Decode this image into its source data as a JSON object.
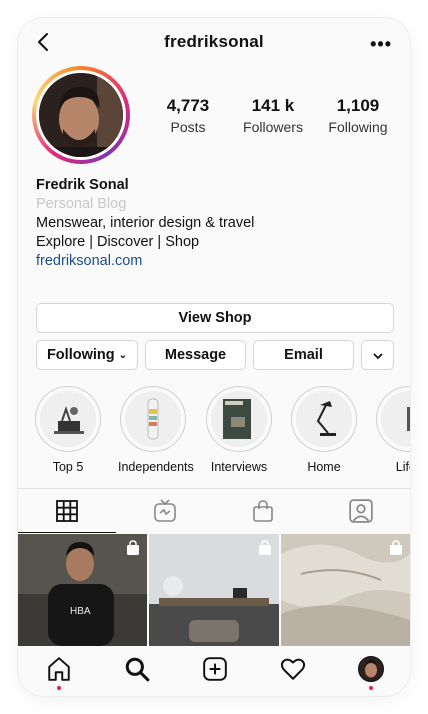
{
  "header": {
    "username": "fredriksonal",
    "more_icon": "more-icon"
  },
  "profile": {
    "stats": [
      {
        "value": "4,773",
        "label": "Posts"
      },
      {
        "value": "141 k",
        "label": "Followers"
      },
      {
        "value": "1,109",
        "label": "Following"
      }
    ],
    "name": "Fredrik Sonal",
    "category": "Personal Blog",
    "bio_line1": "Menswear, interior design & travel",
    "bio_line2": "Explore | Discover | Shop",
    "link": "fredriksonal.com"
  },
  "actions": {
    "view_shop": "View Shop",
    "following": "Following",
    "message": "Message",
    "email": "Email"
  },
  "highlights": [
    {
      "label": "Top 5"
    },
    {
      "label": "Independents"
    },
    {
      "label": "Interviews"
    },
    {
      "label": "Home"
    },
    {
      "label": "Lifes"
    }
  ],
  "tabs": [
    "grid-icon",
    "igtv-icon",
    "shop-icon",
    "tagged-icon"
  ],
  "bottom_nav": [
    "home-icon",
    "search-icon",
    "add-icon",
    "activity-icon",
    "profile-avatar"
  ],
  "colors": {
    "accent_link": "#1f4d8a",
    "notification_dot": "#e0245e"
  }
}
